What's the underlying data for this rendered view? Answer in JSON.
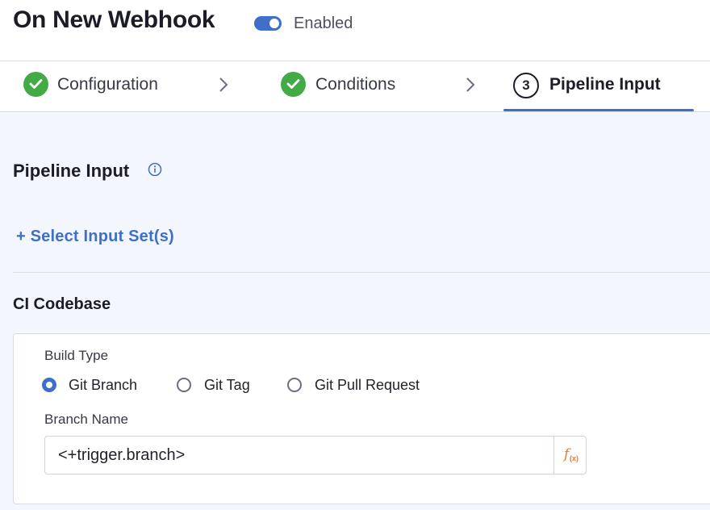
{
  "header": {
    "title": "On New Webhook",
    "toggle": {
      "on": true,
      "label": "Enabled"
    }
  },
  "steps": [
    {
      "label": "Configuration",
      "state": "complete",
      "icon": "check-circle-icon"
    },
    {
      "label": "Conditions",
      "state": "complete",
      "icon": "check-circle-icon"
    },
    {
      "label": "Pipeline Input",
      "state": "active",
      "number": "3"
    }
  ],
  "main": {
    "section_title": "Pipeline Input",
    "select_input_sets": "+ Select Input Set(s)",
    "codebase_title": "CI Codebase",
    "build_type": {
      "label": "Build Type",
      "options": [
        "Git Branch",
        "Git Tag",
        "Git Pull Request"
      ],
      "selected": "Git Branch"
    },
    "branch_name": {
      "label": "Branch Name",
      "value": "<+trigger.branch>",
      "fx_label": "f",
      "fx_sub": "(x)"
    }
  },
  "colors": {
    "accent": "#3e6fc9",
    "success": "#42ab45",
    "fx": "#e07a2e"
  }
}
